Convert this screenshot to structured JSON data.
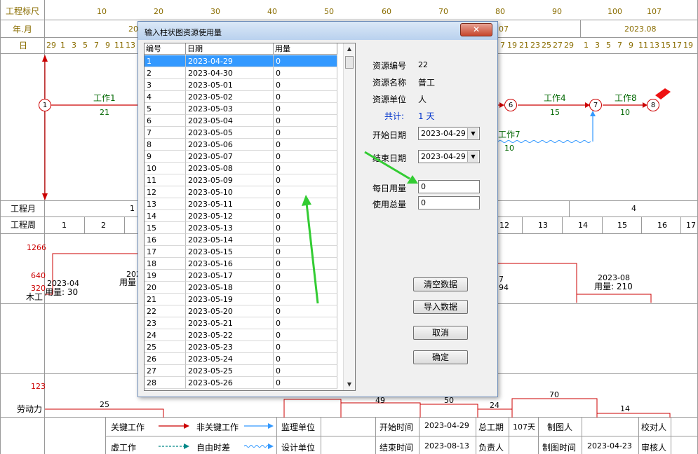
{
  "chart": {
    "ruler_label": "工程标尺",
    "ruler_ticks": [
      "10",
      "20",
      "30",
      "40",
      "50",
      "60",
      "70",
      "80",
      "90",
      "100",
      "107"
    ],
    "year_month_label": "年.月",
    "month_labels": [
      "20",
      "07",
      "2023.08"
    ],
    "day_label": "日",
    "days_left": [
      "29",
      "1",
      "3",
      "5",
      "7",
      "9",
      "11",
      "13"
    ],
    "days_right": [
      "7",
      "19",
      "21",
      "23",
      "25",
      "27",
      "29"
    ],
    "days_far_right": [
      "1",
      "3",
      "5",
      "7",
      "9",
      "11",
      "13",
      "15",
      "17",
      "19"
    ],
    "project_month_label": "工程月",
    "project_months": [
      "1",
      "4"
    ],
    "project_week_label": "工程周",
    "weeks_left": [
      "1",
      "2"
    ],
    "weeks_right": [
      "12",
      "13",
      "14",
      "15",
      "16",
      "17"
    ],
    "resource_mugong": "木工",
    "resource_laodong": "劳动力",
    "y_values": [
      "1266",
      "640",
      "320",
      "123"
    ]
  },
  "network": {
    "nodes": [
      "1",
      "6",
      "7",
      "8"
    ],
    "work1_name": "工作1",
    "work1_dur": "21",
    "work4_name": "工作4",
    "work4_dur": "15",
    "work8_name": "工作8",
    "work8_dur": "10",
    "work7_name": "工作7",
    "work7_dur": "10"
  },
  "histogram": {
    "left_date": "2023-04",
    "left_usage": "用量: 30",
    "left2_date": "202",
    "left2_usage": "用量",
    "right_frag1": "7",
    "right_frag2": "94",
    "right_date": "2023-08",
    "right_usage": "用量: 210",
    "labor_25": "25",
    "labor_49": "49",
    "labor_50": "50",
    "labor_24": "24",
    "labor_70": "70",
    "labor_14": "14"
  },
  "legend": {
    "critical": "关键工作",
    "non_critical": "非关键工作",
    "dummy": "虚工作",
    "free_float": "自由时差",
    "supervisor": "监理单位",
    "designer": "设计单位",
    "start_time_label": "开始时间",
    "start_time": "2023-04-29",
    "end_time_label": "结束时间",
    "end_time": "2023-08-13",
    "total_duration_label": "总工期",
    "total_duration": "107天",
    "owner_label": "负责人",
    "drawer_label": "制图人",
    "draw_time_label": "制图时间",
    "draw_time": "2023-04-23",
    "checker_label": "校对人",
    "reviewer_label": "审核人"
  },
  "dialog": {
    "title": "输入柱状图资源使用量",
    "close": "✕",
    "columns": [
      "编号",
      "日期",
      "用量"
    ],
    "rows": [
      [
        "1",
        "2023-04-29",
        "0"
      ],
      [
        "2",
        "2023-04-30",
        "0"
      ],
      [
        "3",
        "2023-05-01",
        "0"
      ],
      [
        "4",
        "2023-05-02",
        "0"
      ],
      [
        "5",
        "2023-05-03",
        "0"
      ],
      [
        "6",
        "2023-05-04",
        "0"
      ],
      [
        "7",
        "2023-05-05",
        "0"
      ],
      [
        "8",
        "2023-05-06",
        "0"
      ],
      [
        "9",
        "2023-05-07",
        "0"
      ],
      [
        "10",
        "2023-05-08",
        "0"
      ],
      [
        "11",
        "2023-05-09",
        "0"
      ],
      [
        "12",
        "2023-05-10",
        "0"
      ],
      [
        "13",
        "2023-05-11",
        "0"
      ],
      [
        "14",
        "2023-05-12",
        "0"
      ],
      [
        "15",
        "2023-05-13",
        "0"
      ],
      [
        "16",
        "2023-05-14",
        "0"
      ],
      [
        "17",
        "2023-05-15",
        "0"
      ],
      [
        "18",
        "2023-05-16",
        "0"
      ],
      [
        "19",
        "2023-05-17",
        "0"
      ],
      [
        "20",
        "2023-05-18",
        "0"
      ],
      [
        "21",
        "2023-05-19",
        "0"
      ],
      [
        "22",
        "2023-05-20",
        "0"
      ],
      [
        "23",
        "2023-05-21",
        "0"
      ],
      [
        "24",
        "2023-05-22",
        "0"
      ],
      [
        "25",
        "2023-05-23",
        "0"
      ],
      [
        "26",
        "2023-05-24",
        "0"
      ],
      [
        "27",
        "2023-05-25",
        "0"
      ],
      [
        "28",
        "2023-05-26",
        "0"
      ]
    ],
    "resource_id_label": "资源编号",
    "resource_id": "22",
    "resource_name_label": "资源名称",
    "resource_name": "普工",
    "resource_unit_label": "资源单位",
    "resource_unit": "人",
    "total_label": "共计:",
    "total_value": "1 天",
    "start_date_label": "开始日期",
    "start_date": "2023-04-29",
    "end_date_label": "结束日期",
    "end_date": "2023-04-29",
    "daily_usage_label": "每日用量",
    "daily_usage": "0",
    "total_usage_label": "使用总量",
    "total_usage": "0",
    "btn_clear": "清空数据",
    "btn_import": "导入数据",
    "btn_cancel": "取消",
    "btn_ok": "确定"
  }
}
